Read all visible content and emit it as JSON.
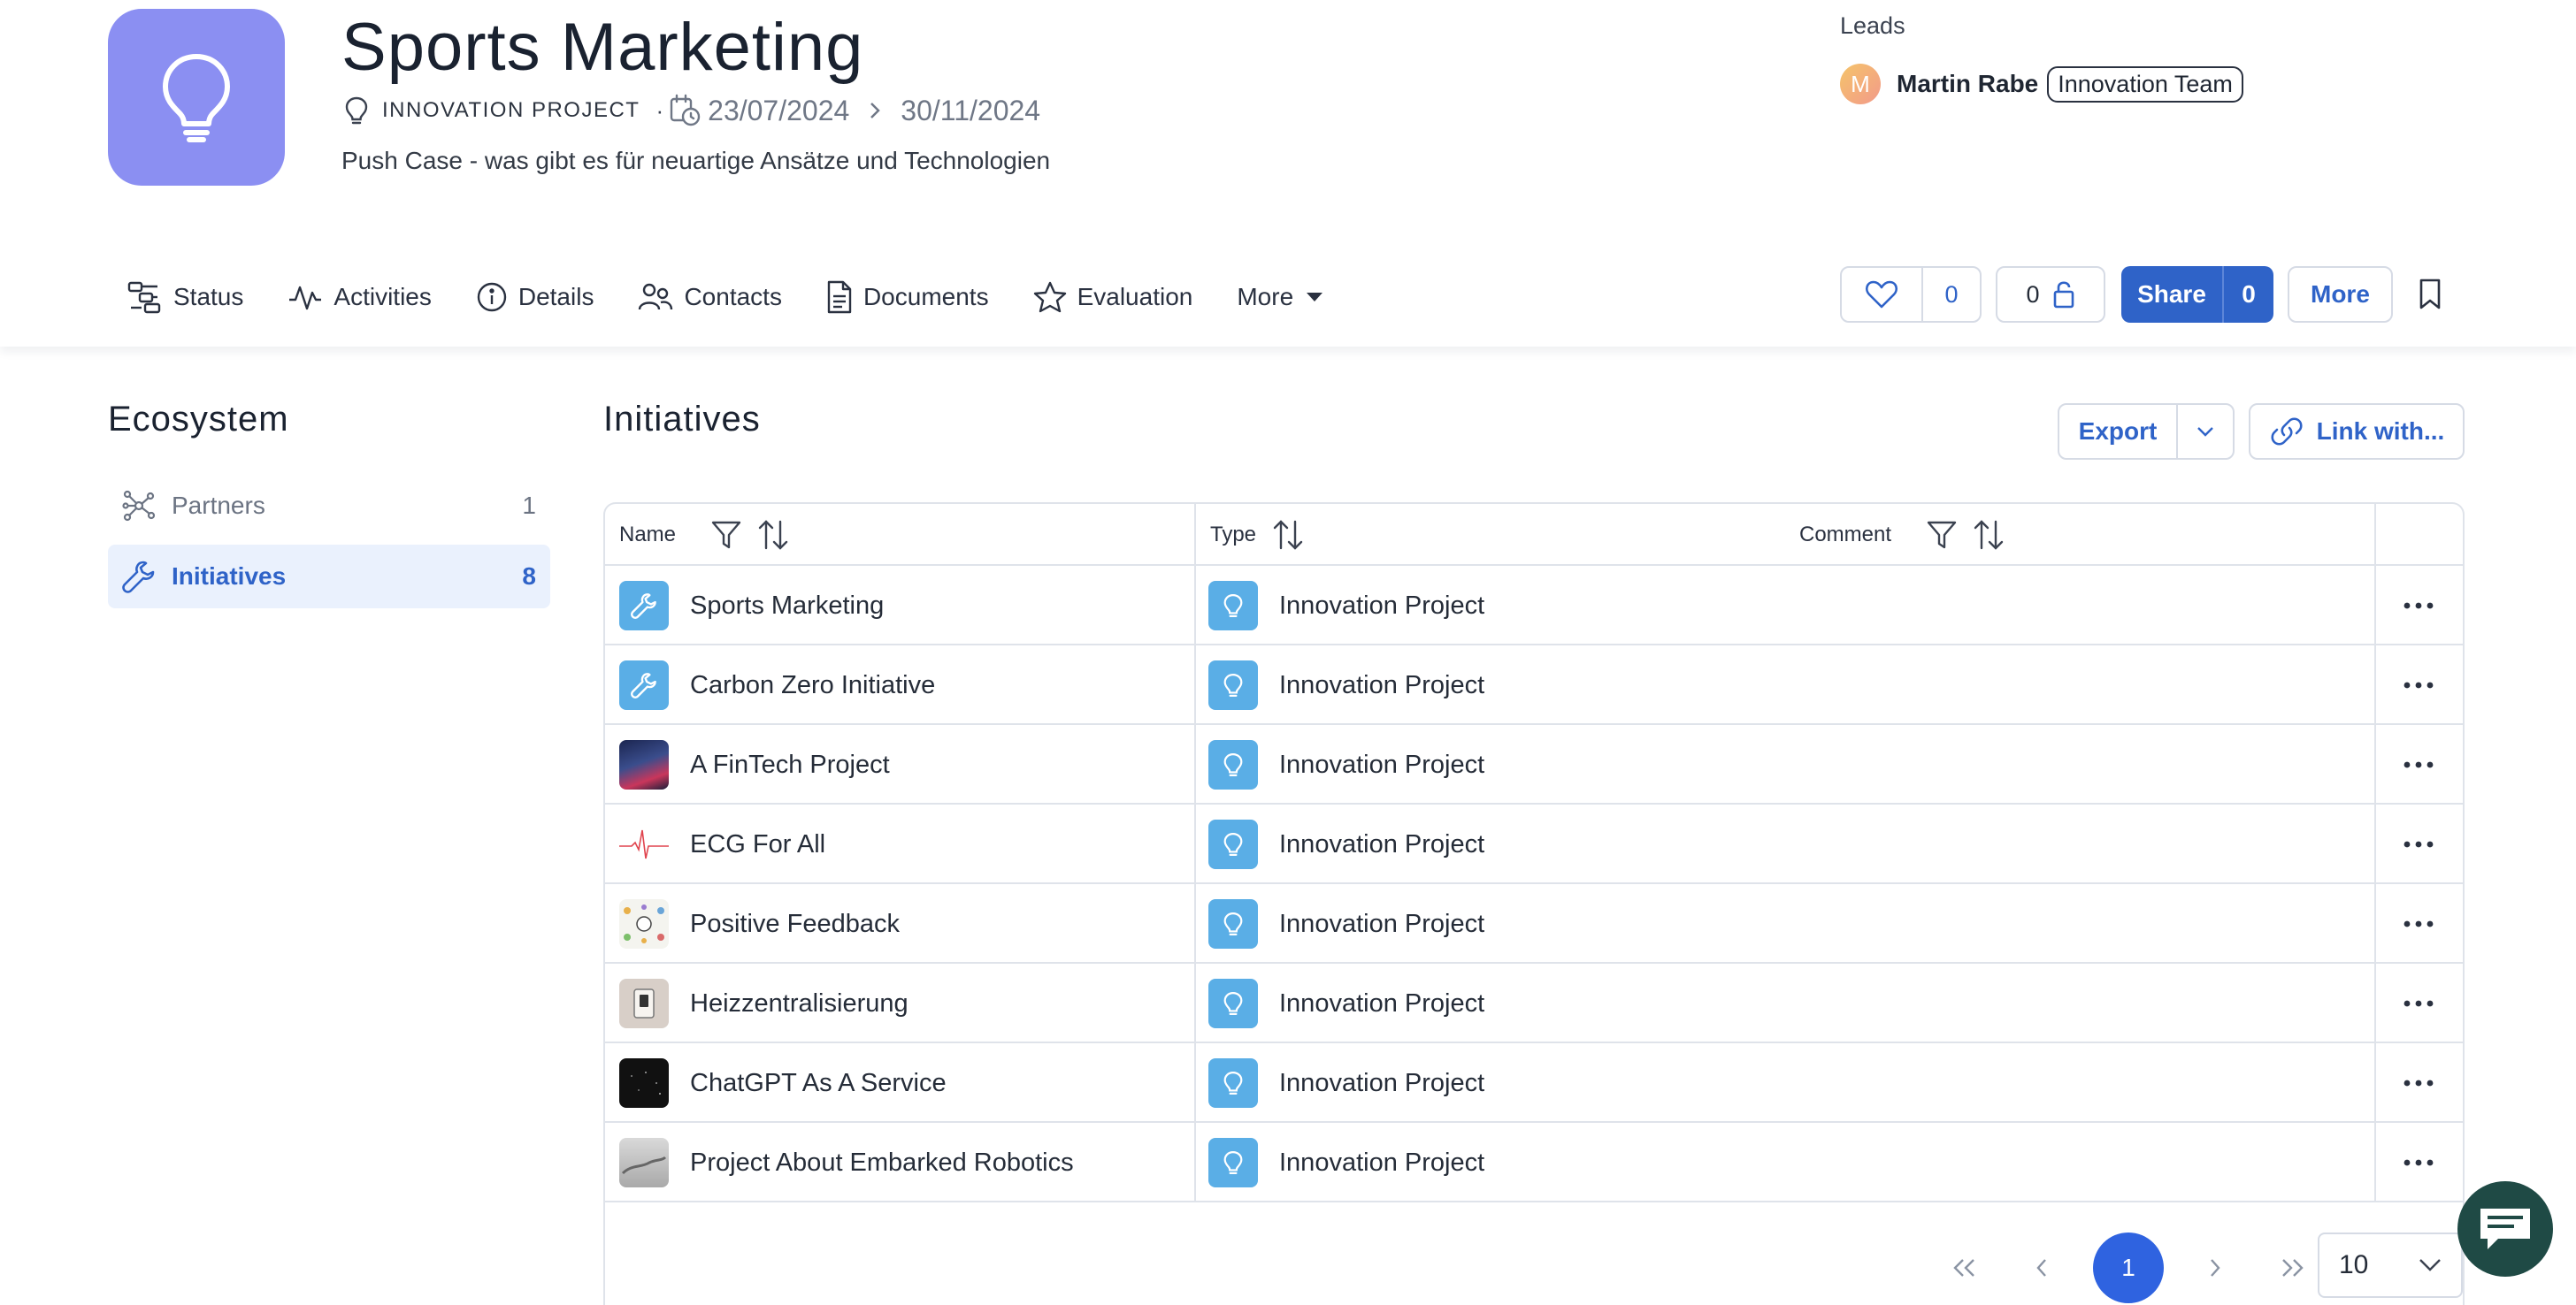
{
  "project": {
    "title": "Sports Marketing",
    "type": "INNOVATION PROJECT",
    "separator": "·",
    "start_date": "23/07/2024",
    "end_date": "30/11/2024",
    "description": "Push Case - was gibt es für neuartige Ansätze und Technologien",
    "avatar_icon": "lightbulb-icon",
    "avatar_color": "#8b8ff2"
  },
  "leads": {
    "label": "Leads",
    "avatar_initial": "M",
    "name": "Martin Rabe",
    "team": "Innovation Team"
  },
  "tabs": [
    {
      "label": "Status",
      "icon": "status-icon"
    },
    {
      "label": "Activities",
      "icon": "activity-icon"
    },
    {
      "label": "Details",
      "icon": "info-icon"
    },
    {
      "label": "Contacts",
      "icon": "contacts-icon"
    },
    {
      "label": "Documents",
      "icon": "document-icon"
    },
    {
      "label": "Evaluation",
      "icon": "star-icon"
    },
    {
      "label": "More",
      "icon": "caret-down-icon"
    }
  ],
  "actions": {
    "likes": "0",
    "locks": "0",
    "share_label": "Share",
    "share_count": "0",
    "more_label": "More"
  },
  "sidebar": {
    "title": "Ecosystem",
    "items": [
      {
        "label": "Partners",
        "count": "1",
        "icon": "network-icon",
        "active": false
      },
      {
        "label": "Initiatives",
        "count": "8",
        "icon": "wrench-icon",
        "active": true
      }
    ]
  },
  "main": {
    "title": "Initiatives",
    "export_label": "Export",
    "link_label": "Link with...",
    "columns": {
      "name": "Name",
      "type": "Type",
      "comment": "Comment"
    },
    "rows": [
      {
        "name": "Sports Marketing",
        "type": "Innovation Project",
        "thumb": "wrench"
      },
      {
        "name": "Carbon Zero Initiative",
        "type": "Innovation Project",
        "thumb": "wrench"
      },
      {
        "name": "A FinTech Project",
        "type": "Innovation Project",
        "thumb": "fintech"
      },
      {
        "name": "ECG For All",
        "type": "Innovation Project",
        "thumb": "ecg"
      },
      {
        "name": "Positive Feedback",
        "type": "Innovation Project",
        "thumb": "feedback"
      },
      {
        "name": "Heizzentralisierung",
        "type": "Innovation Project",
        "thumb": "heater"
      },
      {
        "name": "ChatGPT As A Service",
        "type": "Innovation Project",
        "thumb": "chatgpt"
      },
      {
        "name": "Project About Embarked Robotics",
        "type": "Innovation Project",
        "thumb": "robotics"
      }
    ]
  },
  "pagination": {
    "current_page": "1",
    "page_size": "10"
  },
  "colors": {
    "accent": "#2f63c8",
    "type_icon_bg": "#5aaee6",
    "active_bg": "#eaf1fd",
    "chat_bg": "#1f4a45"
  }
}
